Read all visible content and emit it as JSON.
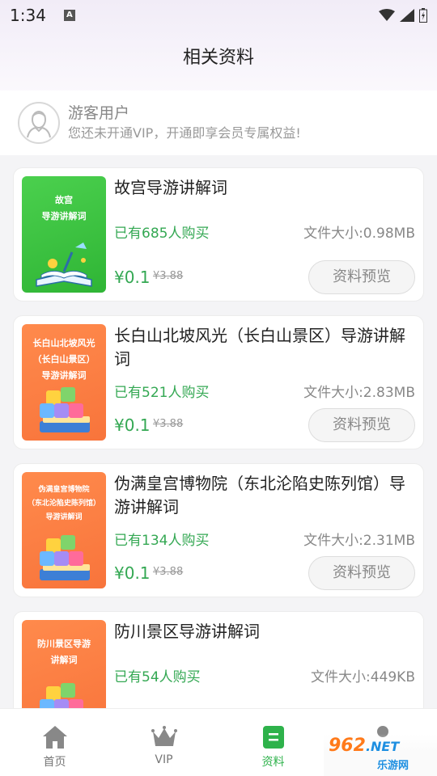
{
  "status_bar": {
    "time": "1:34"
  },
  "header": {
    "title": "相关资料"
  },
  "user": {
    "name": "游客用户",
    "subtitle": "您还未开通VIP，开通即享会员专属权益!"
  },
  "items": [
    {
      "title": "故宫导游讲解词",
      "thumb_text": "故宫\n导游讲解词",
      "buyers": "已有685人购买",
      "file_size": "文件大小:0.98MB",
      "price": "¥0.1",
      "original_price": "¥3.88",
      "preview_label": "资料预览"
    },
    {
      "title": "长白山北坡风光（长白山景区）导游讲解词",
      "thumb_text": "长白山北坡风光\n（长白山景区）\n导游讲解词",
      "buyers": "已有521人购买",
      "file_size": "文件大小:2.83MB",
      "price": "¥0.1",
      "original_price": "¥3.88",
      "preview_label": "资料预览"
    },
    {
      "title": "伪满皇宫博物院（东北沦陷史陈列馆）导游讲解词",
      "thumb_text": "伪满皇宫博物院\n（东北沦陷史陈列馆）\n导游讲解词",
      "buyers": "已有134人购买",
      "file_size": "文件大小:2.31MB",
      "price": "¥0.1",
      "original_price": "¥3.88",
      "preview_label": "资料预览"
    },
    {
      "title": "防川景区导游讲解词",
      "thumb_text": "防川景区导游\n讲解词",
      "buyers": "已有54人购买",
      "file_size": "文件大小:449KB",
      "price": "",
      "original_price": "",
      "preview_label": ""
    }
  ],
  "tabbar": {
    "tabs": [
      {
        "label": "首页",
        "icon": "home-icon"
      },
      {
        "label": "VIP",
        "icon": "crown-icon"
      },
      {
        "label": "资料",
        "icon": "document-icon",
        "active": true
      },
      {
        "label": "",
        "icon": "profile-icon"
      }
    ]
  },
  "watermark": {
    "logo": "962",
    "net": ".NET",
    "sub": "乐游网"
  },
  "colors": {
    "accent_green": "#34a853",
    "thumb_green": "#3cc442",
    "thumb_orange": "#f8743b"
  }
}
